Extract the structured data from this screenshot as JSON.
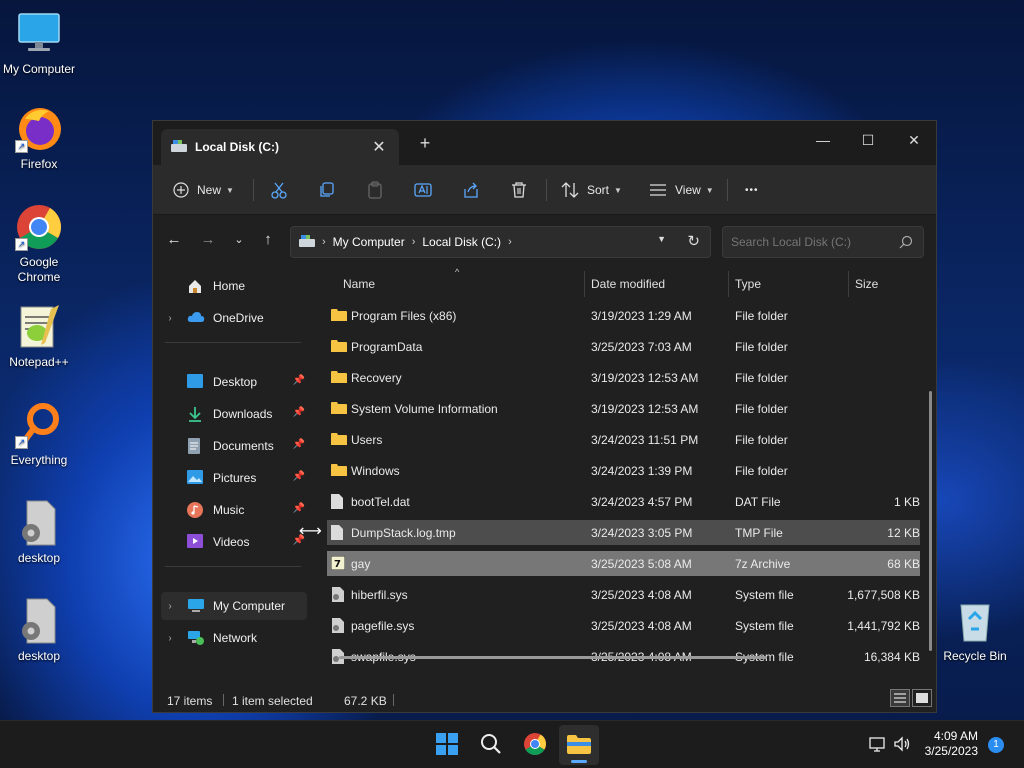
{
  "desktop": {
    "icons": [
      {
        "label": "My Computer",
        "icon": "monitor-icon"
      },
      {
        "label": "Firefox",
        "icon": "firefox-icon"
      },
      {
        "label": "Google Chrome",
        "icon": "chrome-icon"
      },
      {
        "label": "Notepad++",
        "icon": "notepadpp-icon"
      },
      {
        "label": "Everything",
        "icon": "everything-icon"
      },
      {
        "label": "desktop",
        "icon": "settings-file-icon"
      },
      {
        "label": "desktop",
        "icon": "settings-file-icon"
      },
      {
        "label": "Recycle Bin",
        "icon": "recycle-bin-icon"
      }
    ]
  },
  "window": {
    "tab_title": "Local Disk (C:)",
    "tab_close": "✕",
    "new_tab": "+",
    "controls": {
      "minimize": "—",
      "maximize": "☐",
      "close": "✕"
    }
  },
  "toolbar": {
    "new_label": "New",
    "sort_label": "Sort",
    "view_label": "View",
    "more_label": "•••"
  },
  "navigation": {
    "breadcrumbs": [
      "My Computer",
      "Local Disk (C:)"
    ],
    "search_placeholder": "Search Local Disk (C:)"
  },
  "sidebar": {
    "home": "Home",
    "onedrive": "OneDrive",
    "quick_access": [
      {
        "label": "Desktop",
        "icon": "desktop-folder-icon"
      },
      {
        "label": "Downloads",
        "icon": "download-icon"
      },
      {
        "label": "Documents",
        "icon": "documents-icon"
      },
      {
        "label": "Pictures",
        "icon": "pictures-icon"
      },
      {
        "label": "Music",
        "icon": "music-icon"
      },
      {
        "label": "Videos",
        "icon": "videos-icon"
      }
    ],
    "my_computer": "My Computer",
    "network": "Network"
  },
  "columns": {
    "name": "Name",
    "date": "Date modified",
    "type": "Type",
    "size": "Size"
  },
  "files": [
    {
      "name": "Program Files (x86)",
      "date": "3/19/2023 1:29 AM",
      "type": "File folder",
      "size": "",
      "kind": "folder"
    },
    {
      "name": "ProgramData",
      "date": "3/25/2023 7:03 AM",
      "type": "File folder",
      "size": "",
      "kind": "folder"
    },
    {
      "name": "Recovery",
      "date": "3/19/2023 12:53 AM",
      "type": "File folder",
      "size": "",
      "kind": "folder"
    },
    {
      "name": "System Volume Information",
      "date": "3/19/2023 12:53 AM",
      "type": "File folder",
      "size": "",
      "kind": "folder"
    },
    {
      "name": "Users",
      "date": "3/24/2023 11:51 PM",
      "type": "File folder",
      "size": "",
      "kind": "folder"
    },
    {
      "name": "Windows",
      "date": "3/24/2023 1:39 PM",
      "type": "File folder",
      "size": "",
      "kind": "folder"
    },
    {
      "name": "bootTel.dat",
      "date": "3/24/2023 4:57 PM",
      "type": "DAT File",
      "size": "1 KB",
      "kind": "file"
    },
    {
      "name": "DumpStack.log.tmp",
      "date": "3/24/2023 3:05 PM",
      "type": "TMP File",
      "size": "12 KB",
      "kind": "file"
    },
    {
      "name": "gay",
      "date": "3/25/2023 5:08 AM",
      "type": "7z Archive",
      "size": "68 KB",
      "kind": "archive"
    },
    {
      "name": "hiberfil.sys",
      "date": "3/25/2023 4:08 AM",
      "type": "System file",
      "size": "1,677,508 KB",
      "kind": "sysfile"
    },
    {
      "name": "pagefile.sys",
      "date": "3/25/2023 4:08 AM",
      "type": "System file",
      "size": "1,441,792 KB",
      "kind": "sysfile"
    },
    {
      "name": "swapfile.sys",
      "date": "3/25/2023 4:08 AM",
      "type": "System file",
      "size": "16,384 KB",
      "kind": "sysfile"
    }
  ],
  "status": {
    "count": "17 items",
    "selected": "1 item selected",
    "size": "67.2 KB"
  },
  "taskbar": {
    "time": "4:09 AM",
    "date": "3/25/2023",
    "notifications": "1"
  }
}
